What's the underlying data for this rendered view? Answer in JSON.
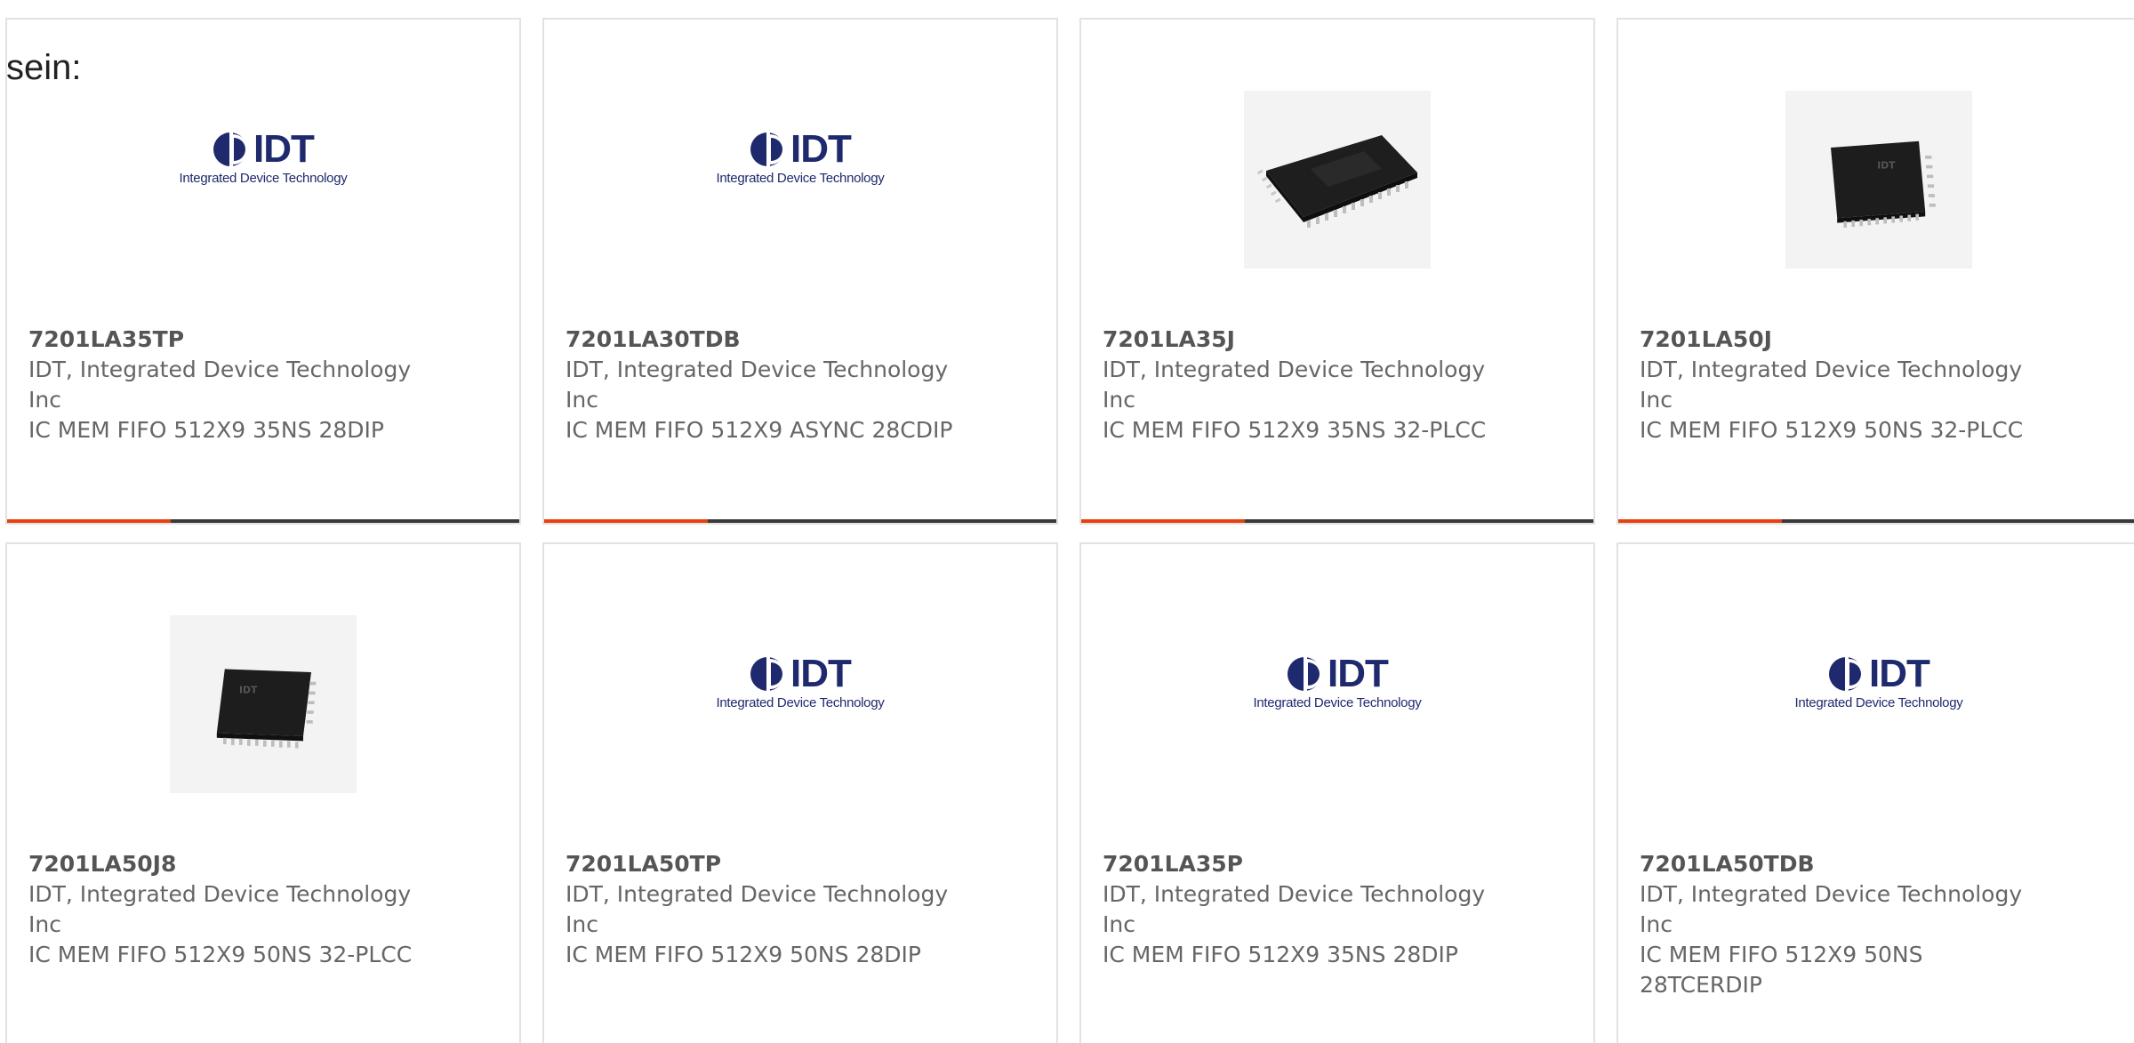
{
  "intro": {
    "text": "sein:"
  },
  "cards": [
    {
      "part_number": "7201LA35TP",
      "manufacturer": "IDT, Integrated Device Technology Inc",
      "description": "IC MEM FIFO 512X9 35NS 28DIP",
      "image": "idt-logo",
      "logo_text": "IDT",
      "logo_subtitle": "Integrated Device Technology"
    },
    {
      "part_number": "7201LA30TDB",
      "manufacturer": "IDT, Integrated Device Technology Inc",
      "description": "IC MEM FIFO 512X9 ASYNC 28CDIP",
      "image": "idt-logo",
      "logo_text": "IDT",
      "logo_subtitle": "Integrated Device Technology"
    },
    {
      "part_number": "7201LA35J",
      "manufacturer": "IDT, Integrated Device Technology Inc",
      "description": "IC MEM FIFO 512X9 35NS 32-PLCC",
      "image": "plcc-chip-photo"
    },
    {
      "part_number": "7201LA50J",
      "manufacturer": "IDT, Integrated Device Technology Inc",
      "description": "IC MEM FIFO 512X9 50NS 32-PLCC",
      "image": "plcc-chip-photo"
    },
    {
      "part_number": "7201LA50J8",
      "manufacturer": "IDT, Integrated Device Technology Inc",
      "description": "IC MEM FIFO 512X9 50NS 32-PLCC",
      "image": "plcc-chip-photo"
    },
    {
      "part_number": "7201LA50TP",
      "manufacturer": "IDT, Integrated Device Technology Inc",
      "description": "IC MEM FIFO 512X9 50NS 28DIP",
      "image": "idt-logo",
      "logo_text": "IDT",
      "logo_subtitle": "Integrated Device Technology"
    },
    {
      "part_number": "7201LA35P",
      "manufacturer": "IDT, Integrated Device Technology Inc",
      "description": "IC MEM FIFO 512X9 35NS 28DIP",
      "image": "idt-logo",
      "logo_text": "IDT",
      "logo_subtitle": "Integrated Device Technology"
    },
    {
      "part_number": "7201LA50TDB",
      "manufacturer": "IDT, Integrated Device Technology Inc",
      "description": "IC MEM FIFO 512X9 50NS 28TCERDIP",
      "image": "idt-logo",
      "logo_text": "IDT",
      "logo_subtitle": "Integrated Device Technology"
    }
  ],
  "colors": {
    "accent": "#e8400f",
    "bar_dark": "#3a3a3a",
    "card_border": "#e2e2e2",
    "text": "#666666",
    "logo_blue": "#1f2a6e"
  }
}
